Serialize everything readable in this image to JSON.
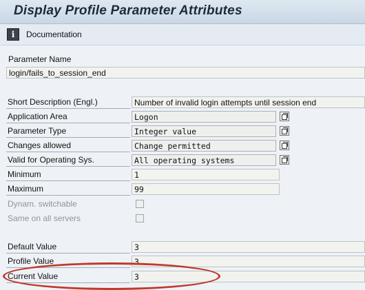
{
  "window": {
    "title": "Display Profile Parameter Attributes"
  },
  "toolbar": {
    "documentation_label": "Documentation"
  },
  "parameter_name": {
    "label": "Parameter Name",
    "value": "login/fails_to_session_end"
  },
  "attributes": {
    "short_description": {
      "label": "Short Description (Engl.)",
      "value": "Number of invalid login attempts until session end"
    },
    "application_area": {
      "label": "Application Area",
      "value": "Logon"
    },
    "parameter_type": {
      "label": "Parameter Type",
      "value": "Integer value"
    },
    "changes_allowed": {
      "label": "Changes allowed",
      "value": "Change permitted"
    },
    "valid_for_os": {
      "label": "Valid for Operating Sys.",
      "value": "All operating systems"
    },
    "minimum": {
      "label": "Minimum",
      "value": "1"
    },
    "maximum": {
      "label": "Maximum",
      "value": "99"
    },
    "dynam_switchable": {
      "label": "Dynam. switchable",
      "checked": false
    },
    "same_on_all_servers": {
      "label": "Same on all servers",
      "checked": false
    }
  },
  "values": {
    "default_value": {
      "label": "Default Value",
      "value": "3"
    },
    "profile_value": {
      "label": "Profile Value",
      "value": "3"
    },
    "current_value": {
      "label": "Current Value",
      "value": "3"
    }
  },
  "highlight": {
    "color": "#c0392b",
    "target": "current_value"
  }
}
